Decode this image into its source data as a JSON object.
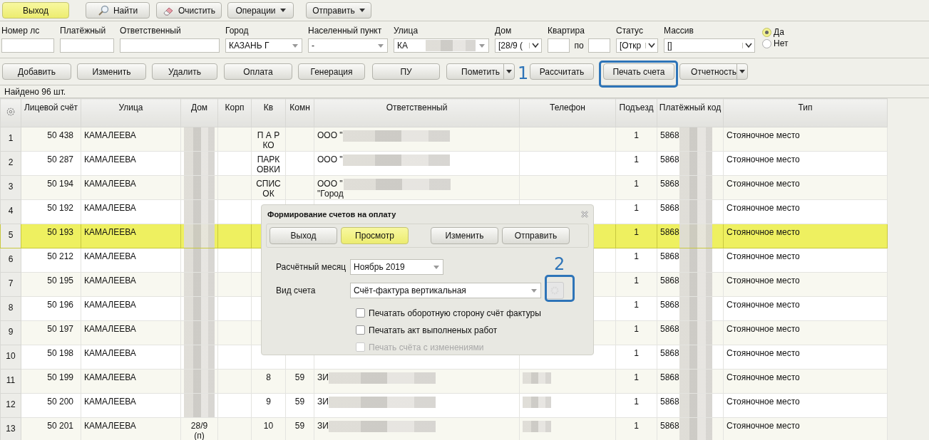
{
  "toolbar": [
    {
      "label": "Выход",
      "kind": "primary"
    },
    {
      "label": "Найти",
      "kind": "search"
    },
    {
      "label": "Очистить",
      "kind": "eraser"
    },
    {
      "label": "Операции",
      "kind": "dropdown"
    },
    {
      "label": "Отправить",
      "kind": "dropdown"
    }
  ],
  "filters": [
    {
      "label": "Номер лс",
      "kind": "text"
    },
    {
      "label": "Платёжный",
      "kind": "text"
    },
    {
      "label": "Ответственный",
      "kind": "text"
    },
    {
      "label": "Город",
      "kind": "combo",
      "value": "КАЗАНЬ Г"
    },
    {
      "label": "Населенный пункт",
      "kind": "combo",
      "value": "-"
    },
    {
      "label": "Улица",
      "kind": "combo",
      "value": "КА",
      "redacted": true
    },
    {
      "label": "Дом",
      "kind": "select",
      "value": "[28/9 ("
    },
    {
      "label": "Квартира",
      "kind": "range",
      "separator": "по"
    },
    {
      "label": "Статус",
      "kind": "select",
      "value": "[Откр"
    },
    {
      "label": "Массив",
      "kind": "select",
      "value": "[]"
    }
  ],
  "radios": [
    {
      "label": "Да",
      "selected": true
    },
    {
      "label": "Нет",
      "selected": false
    }
  ],
  "actions": [
    {
      "label": "Добавить",
      "kind": "plain"
    },
    {
      "label": "Изменить",
      "kind": "plain"
    },
    {
      "label": "Удалить",
      "kind": "plain"
    },
    {
      "label": "Оплата",
      "kind": "plain"
    },
    {
      "label": "Генерация",
      "kind": "plain"
    },
    {
      "label": "ПУ",
      "kind": "plain"
    },
    {
      "label": "Пометить",
      "kind": "split"
    },
    {
      "label": "Рассчитать",
      "kind": "plain"
    },
    {
      "label": "Печать счета",
      "kind": "plain"
    },
    {
      "label": "Отчетность",
      "kind": "split"
    }
  ],
  "status": "Найдено 96 шт.",
  "table": {
    "columns": [
      "Лицевой счёт",
      "Улица",
      "Дом",
      "Корп",
      "Кв",
      "Комн",
      "Ответственный",
      "Телефон",
      "Подъезд",
      "Платёжный код",
      "Тип"
    ],
    "rows": [
      {
        "num": "1",
        "account": "50 438",
        "street": "КАМАЛЕЕВА",
        "house": {
          "redacted": true
        },
        "kv": "П А РКО",
        "resp": {
          "text": "ООО \"",
          "redacted": true
        },
        "entrance": "1",
        "paycode": {
          "text": "5868",
          "redacted": true
        },
        "type": "Стояночное место",
        "selected": false
      },
      {
        "num": "2",
        "account": "50 287",
        "street": "КАМАЛЕЕВА",
        "house": {
          "redacted": true
        },
        "kv": "ПАРКОВКИ",
        "resp": {
          "text": "ООО \"",
          "redacted": true
        },
        "entrance": "1",
        "paycode": {
          "text": "5868",
          "redacted": true
        },
        "type": "Стояночное место",
        "selected": false
      },
      {
        "num": "3",
        "account": "50 194",
        "street": "КАМАЛЕЕВА",
        "house": {
          "redacted": true
        },
        "kv": "СПИСОК",
        "resp": {
          "text": "ООО \"\n\"Город",
          "redacted": true
        },
        "entrance": "1",
        "paycode": {
          "text": "5868",
          "redacted": true
        },
        "type": "Стояночное место",
        "selected": false
      },
      {
        "num": "4",
        "account": "50 192",
        "street": "КАМАЛЕЕВА",
        "house": {
          "redacted": true
        },
        "entrance": "1",
        "paycode": {
          "text": "5868",
          "redacted": true
        },
        "type": "Стояночное место",
        "selected": false
      },
      {
        "num": "5",
        "account": "50 193",
        "street": "КАМАЛЕЕВА",
        "house": {
          "redacted": true
        },
        "entrance": "1",
        "paycode": {
          "text": "5868",
          "redacted": true
        },
        "type": "Стояночное место",
        "selected": true
      },
      {
        "num": "6",
        "account": "50 212",
        "street": "КАМАЛЕЕВА",
        "house": {
          "redacted": true
        },
        "entrance": "1",
        "paycode": {
          "text": "5868",
          "redacted": true
        },
        "type": "Стояночное место",
        "selected": false
      },
      {
        "num": "7",
        "account": "50 195",
        "street": "КАМАЛЕЕВА",
        "house": {
          "redacted": true
        },
        "entrance": "1",
        "paycode": {
          "text": "5868",
          "redacted": true
        },
        "type": "Стояночное место",
        "selected": false
      },
      {
        "num": "8",
        "account": "50 196",
        "street": "КАМАЛЕЕВА",
        "house": {
          "redacted": true
        },
        "entrance": "1",
        "paycode": {
          "text": "5868",
          "redacted": true
        },
        "type": "Стояночное место",
        "selected": false
      },
      {
        "num": "9",
        "account": "50 197",
        "street": "КАМАЛЕЕВА",
        "house": {
          "redacted": true
        },
        "entrance": "1",
        "paycode": {
          "text": "5868",
          "redacted": true
        },
        "type": "Стояночное место",
        "selected": false
      },
      {
        "num": "10",
        "account": "50 198",
        "street": "КАМАЛЕЕВА",
        "house": {
          "redacted": true
        },
        "entrance": "1",
        "paycode": {
          "text": "5868",
          "redacted": true
        },
        "type": "Стояночное место",
        "selected": false
      },
      {
        "num": "11",
        "account": "50 199",
        "street": "КАМАЛЕЕВА",
        "house": {
          "redacted": true
        },
        "kv": "8",
        "komn": "59",
        "resp": {
          "text": "ЗИ",
          "redacted": true
        },
        "phone": {
          "redacted": true
        },
        "entrance": "1",
        "paycode": {
          "text": "5868",
          "redacted": true
        },
        "type": "Стояночное место",
        "selected": false
      },
      {
        "num": "12",
        "account": "50 200",
        "street": "КАМАЛЕЕВА",
        "house": {
          "redacted": true
        },
        "kv": "9",
        "komn": "59",
        "resp": {
          "text": "ЗИ",
          "redacted": true
        },
        "phone": {
          "redacted": true
        },
        "entrance": "1",
        "paycode": {
          "text": "5868",
          "redacted": true
        },
        "type": "Стояночное место",
        "selected": false
      },
      {
        "num": "13",
        "account": "50 201",
        "street": "КАМАЛЕЕВА",
        "house": {
          "text": "28/9\n(п)"
        },
        "kv": "10",
        "komn": "59",
        "resp": {
          "text": "ЗИ",
          "redacted": true
        },
        "phone": {
          "redacted": true
        },
        "entrance": "1",
        "paycode": {
          "text": "5868",
          "redacted": true
        },
        "type": "Стояночное место",
        "selected": false
      }
    ]
  },
  "dialog": {
    "title": "Формирование счетов на оплату",
    "buttons": [
      {
        "label": "Выход",
        "selected": false
      },
      {
        "label": "Просмотр",
        "selected": true
      },
      {
        "label": "Изменить",
        "selected": false
      },
      {
        "label": "Отправить",
        "selected": false
      }
    ],
    "month": {
      "label": "Расчётный месяц",
      "value": "Ноябрь 2019"
    },
    "invoice_type": {
      "label": "Вид счета",
      "value": "Счёт-фактура вертикальная"
    },
    "checkboxes": [
      {
        "label": "Печатать оборотную сторону счёт фактуры",
        "checked": false,
        "disabled": false
      },
      {
        "label": "Печатать акт выполненых работ",
        "checked": false,
        "disabled": false
      },
      {
        "label": "Печать счёта с изменениями",
        "checked": false,
        "disabled": true
      }
    ]
  },
  "callouts": [
    "1",
    "2"
  ]
}
